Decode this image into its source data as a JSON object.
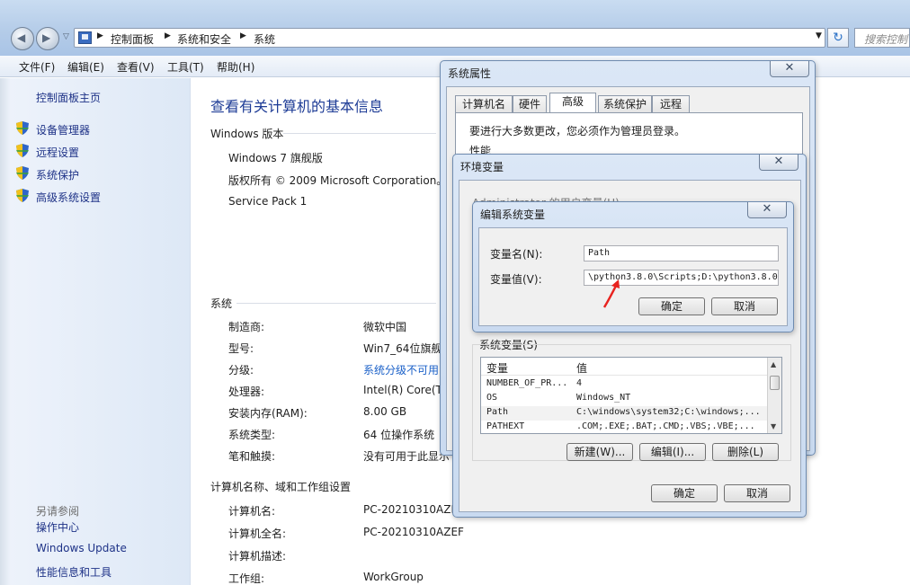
{
  "explorer": {
    "breadcrumbs": [
      "控制面板",
      "系统和安全",
      "系统"
    ],
    "search_placeholder": "搜索控制",
    "menu": [
      "文件(F)",
      "编辑(E)",
      "查看(V)",
      "工具(T)",
      "帮助(H)"
    ]
  },
  "left_pane": {
    "home": "控制面板主页",
    "links": [
      "设备管理器",
      "远程设置",
      "系统保护",
      "高级系统设置"
    ],
    "see_also_title": "另请参阅",
    "see_also": [
      "操作中心",
      "Windows Update",
      "性能信息和工具"
    ]
  },
  "main": {
    "heading": "查看有关计算机的基本信息",
    "windows_edition": {
      "title": "Windows 版本",
      "lines": [
        "Windows 7 旗舰版",
        "版权所有 © 2009 Microsoft Corporation。",
        "Service Pack 1"
      ]
    },
    "system": {
      "title": "系统",
      "rows": [
        {
          "label": "制造商:",
          "value": "微软中国"
        },
        {
          "label": "型号:",
          "value": "Win7_64位旗舰"
        },
        {
          "label": "分级:",
          "value": "系统分级不可用"
        },
        {
          "label": "处理器:",
          "value": "Intel(R) Core(T"
        },
        {
          "label": "安装内存(RAM):",
          "value": "8.00 GB"
        },
        {
          "label": "系统类型:",
          "value": "64 位操作系统"
        },
        {
          "label": "笔和触摸:",
          "value": "没有可用于此显示"
        }
      ]
    },
    "computer": {
      "title": "计算机名称、域和工作组设置",
      "rows": [
        {
          "label": "计算机名:",
          "value": "PC-20210310AZE"
        },
        {
          "label": "计算机全名:",
          "value": "PC-20210310AZEF"
        },
        {
          "label": "计算机描述:",
          "value": ""
        },
        {
          "label": "工作组:",
          "value": "WorkGroup"
        }
      ]
    }
  },
  "sysprops": {
    "title": "系统属性",
    "tabs": [
      "计算机名",
      "硬件",
      "高级",
      "系统保护",
      "远程"
    ],
    "active_tab": "高级",
    "admin_note": "要进行大多数更改，您必须作为管理员登录。",
    "perf_label": "性能"
  },
  "envvars": {
    "title": "环境变量",
    "user_vars_label": "Administrator 的用户变量(U)",
    "sys_vars_label": "系统变量(S)",
    "columns": [
      "变量",
      "值"
    ],
    "sys_rows": [
      {
        "name": "NUMBER_OF_PR...",
        "value": "4"
      },
      {
        "name": "OS",
        "value": "Windows_NT"
      },
      {
        "name": "Path",
        "value": "C:\\windows\\system32;C:\\windows;..."
      },
      {
        "name": "PATHEXT",
        "value": ".COM;.EXE;.BAT;.CMD;.VBS;.VBE;..."
      }
    ],
    "buttons": [
      "新建(W)...",
      "编辑(I)...",
      "删除(L)"
    ],
    "ok": "确定",
    "cancel": "取消"
  },
  "editvar": {
    "title": "编辑系统变量",
    "name_label": "变量名(N):",
    "name_value": "Path",
    "value_label": "变量值(V):",
    "value_value": "\\python3.8.0\\Scripts;D:\\python3.8.0",
    "ok": "确定",
    "cancel": "取消"
  },
  "colors": {
    "annotation_arrow": "#e8231f",
    "link": "#1a60c8",
    "heading": "#1e3c96"
  }
}
